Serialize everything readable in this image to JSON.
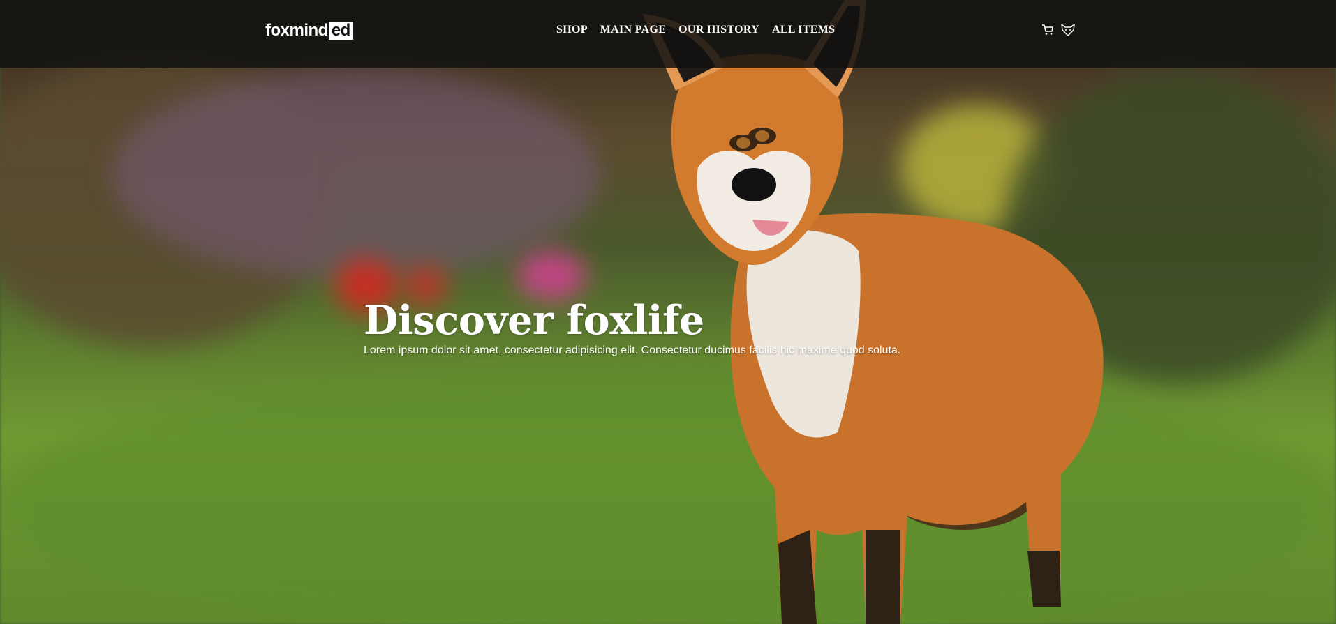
{
  "logo": {
    "text_main": "foxmind",
    "text_boxed": "ed"
  },
  "nav": {
    "items": [
      "SHOP",
      "MAIN PAGE",
      "OUR HISTORY",
      "ALL ITEMS"
    ]
  },
  "icons": {
    "cart": "cart-icon",
    "profile": "fox-icon"
  },
  "hero": {
    "title": "Discover foxlife",
    "subtitle": "Lorem ipsum dolor sit amet, consectetur adipisicing elit. Consectetur ducimus facilis hic maxime quod soluta."
  },
  "colors": {
    "nav_bg": "#121210",
    "text": "#ffffff",
    "grass": "#6f9a33",
    "fox_orange": "#c9722b"
  }
}
